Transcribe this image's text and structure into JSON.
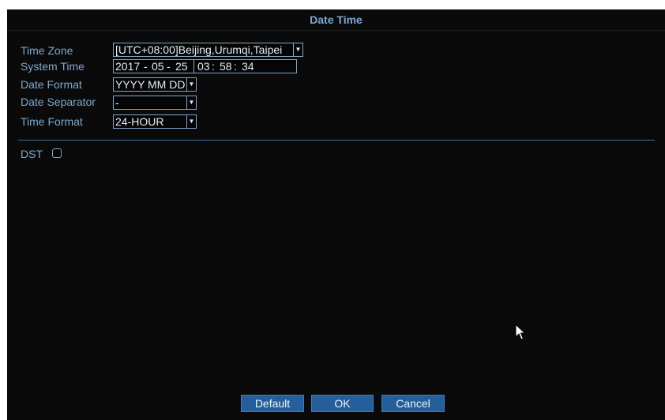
{
  "window": {
    "title": "Date Time"
  },
  "form": {
    "time_zone": {
      "label": "Time Zone",
      "value": "[UTC+08:00]Beijing,Urumqi,Taipei"
    },
    "system_time": {
      "label": "System Time",
      "year": "2017",
      "dash1": "-",
      "month": "05",
      "dash2": "-",
      "day": "25",
      "hour": "03",
      "colon1": ":",
      "minute": "58",
      "colon2": ":",
      "second": "34"
    },
    "date_format": {
      "label": "Date Format",
      "value": "YYYY MM DD"
    },
    "date_separator": {
      "label": "Date Separator",
      "value": "-"
    },
    "time_format": {
      "label": "Time Format",
      "value": "24-HOUR"
    }
  },
  "dst": {
    "label": "DST",
    "checked": false
  },
  "buttons": {
    "default": "Default",
    "ok": "OK",
    "cancel": "Cancel"
  },
  "colors": {
    "background": "#0a0a0a",
    "label_text": "#7fa8ce",
    "field_border": "#7fa8ce",
    "button_fill": "#245f9c",
    "divider": "#3a6e9a"
  },
  "icons": {
    "dropdown": "chevron-down-icon",
    "checkbox": "checkbox-unchecked-icon",
    "cursor": "mouse-pointer-icon"
  }
}
